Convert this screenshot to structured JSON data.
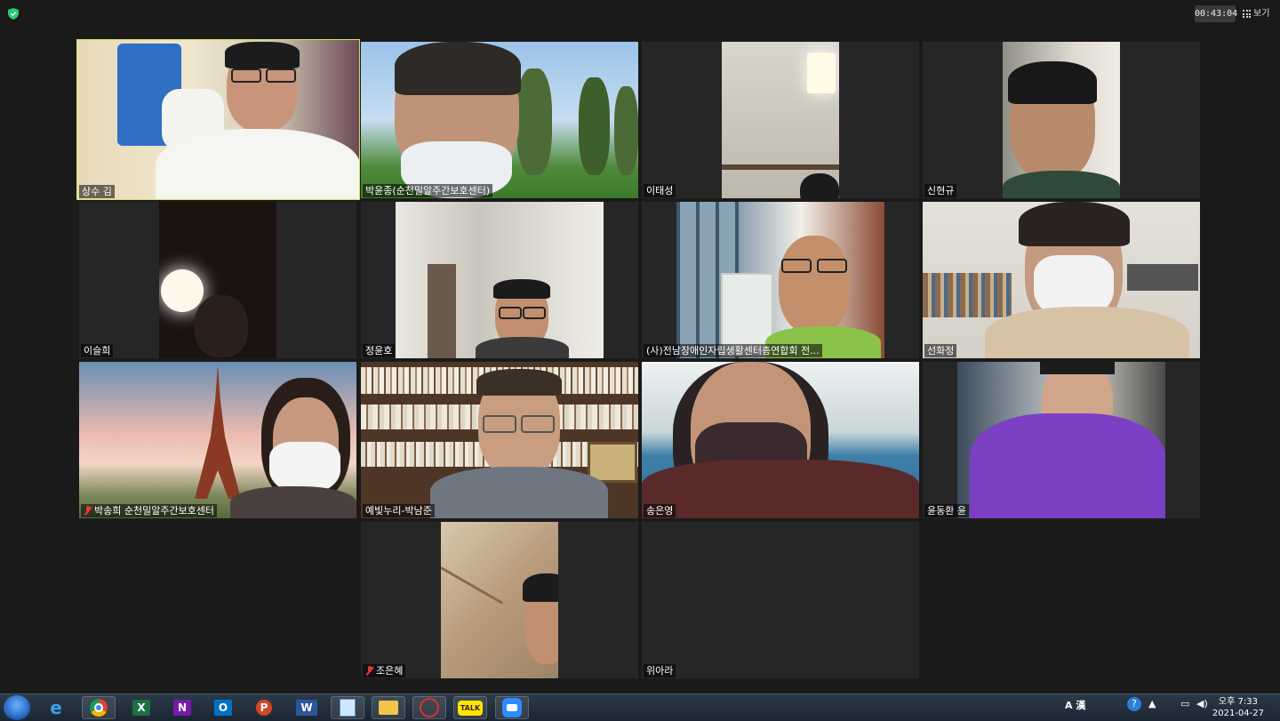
{
  "app": {
    "timer": "00:43:04",
    "view_label": "보기"
  },
  "participants": [
    {
      "name": "상수 김",
      "muted": false,
      "active": true
    },
    {
      "name": "박윤종(순천밀알주간보호센터)",
      "muted": false,
      "active": false
    },
    {
      "name": "이태성",
      "muted": false,
      "active": false
    },
    {
      "name": "신현규",
      "muted": false,
      "active": false
    },
    {
      "name": "이슬희",
      "muted": false,
      "active": false
    },
    {
      "name": "정윤호",
      "muted": false,
      "active": false
    },
    {
      "name": "(사)전남장애인자립생활센터총연합회 전...",
      "muted": false,
      "active": false
    },
    {
      "name": "선화정",
      "muted": false,
      "active": false
    },
    {
      "name": "박송희 순천밀알주간보호센터",
      "muted": true,
      "active": false
    },
    {
      "name": "예빛누리-박남준",
      "muted": false,
      "active": false
    },
    {
      "name": "송은영",
      "muted": false,
      "active": false
    },
    {
      "name": "윤동환 윤",
      "muted": false,
      "active": false
    },
    {
      "name": "조은혜",
      "muted": true,
      "active": false
    },
    {
      "name": "위아라",
      "muted": false,
      "active": false
    }
  ],
  "taskbar": {
    "apps": [
      "Internet Explorer",
      "Chrome",
      "Excel",
      "OneNote",
      "Outlook",
      "PowerPoint",
      "Word",
      "Notepad",
      "File Explorer",
      "Acrobat",
      "KakaoTalk",
      "Zoom"
    ],
    "app_letters": [
      "e",
      "",
      "X",
      "N",
      "O",
      "P",
      "W",
      "",
      "",
      "",
      "TALK",
      ""
    ],
    "tray_ime": "A 漢",
    "clock_time": "오후 7:33",
    "clock_date": "2021-04-27"
  },
  "colors": {
    "background": "#1a1a1a",
    "tile": "#262626",
    "active_border": "#d4e157",
    "muted_icon": "#e53935"
  }
}
